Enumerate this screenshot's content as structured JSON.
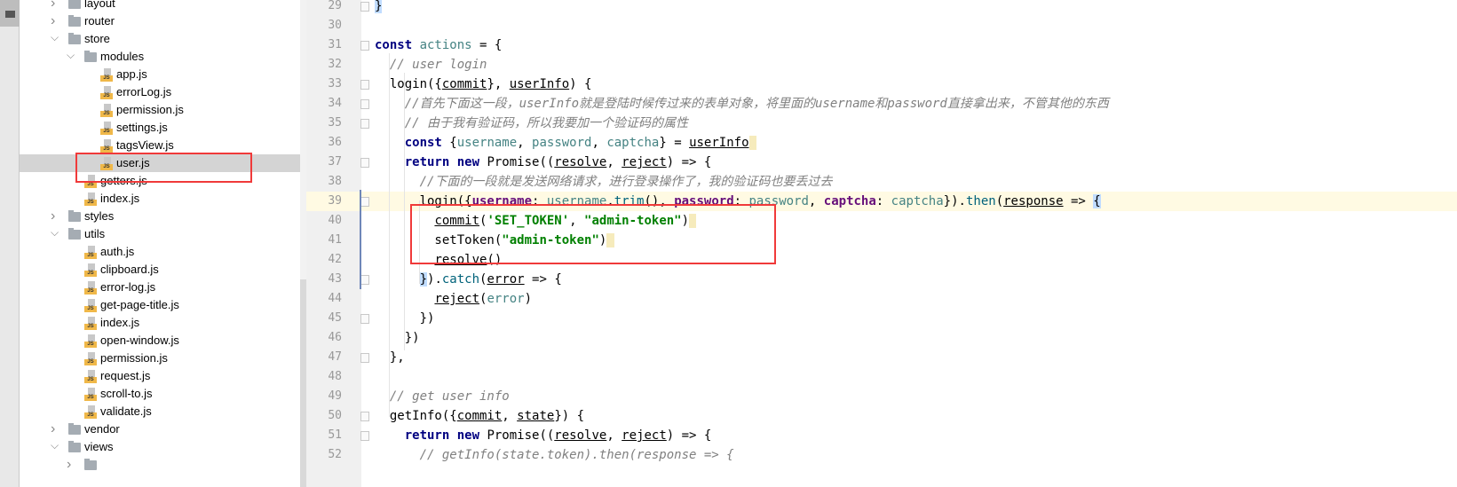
{
  "tree": [
    {
      "label": "layout",
      "type": "folder",
      "depth": 1,
      "expanded": false
    },
    {
      "label": "router",
      "type": "folder",
      "depth": 1,
      "expanded": false
    },
    {
      "label": "store",
      "type": "folder",
      "depth": 1,
      "expanded": true
    },
    {
      "label": "modules",
      "type": "folder",
      "depth": 2,
      "expanded": true
    },
    {
      "label": "app.js",
      "type": "js",
      "depth": 3
    },
    {
      "label": "errorLog.js",
      "type": "js",
      "depth": 3
    },
    {
      "label": "permission.js",
      "type": "js",
      "depth": 3
    },
    {
      "label": "settings.js",
      "type": "js",
      "depth": 3
    },
    {
      "label": "tagsView.js",
      "type": "js",
      "depth": 3
    },
    {
      "label": "user.js",
      "type": "js",
      "depth": 3,
      "selected": true
    },
    {
      "label": "getters.js",
      "type": "js",
      "depth": 2
    },
    {
      "label": "index.js",
      "type": "js",
      "depth": 2
    },
    {
      "label": "styles",
      "type": "folder",
      "depth": 1,
      "expanded": false
    },
    {
      "label": "utils",
      "type": "folder",
      "depth": 1,
      "expanded": true
    },
    {
      "label": "auth.js",
      "type": "js",
      "depth": 2
    },
    {
      "label": "clipboard.js",
      "type": "js",
      "depth": 2
    },
    {
      "label": "error-log.js",
      "type": "js",
      "depth": 2
    },
    {
      "label": "get-page-title.js",
      "type": "js",
      "depth": 2
    },
    {
      "label": "index.js",
      "type": "js",
      "depth": 2
    },
    {
      "label": "open-window.js",
      "type": "js",
      "depth": 2
    },
    {
      "label": "permission.js",
      "type": "js",
      "depth": 2
    },
    {
      "label": "request.js",
      "type": "js",
      "depth": 2
    },
    {
      "label": "scroll-to.js",
      "type": "js",
      "depth": 2
    },
    {
      "label": "validate.js",
      "type": "js",
      "depth": 2
    },
    {
      "label": "vendor",
      "type": "folder",
      "depth": 1,
      "expanded": false
    },
    {
      "label": "views",
      "type": "folder",
      "depth": 1,
      "expanded": true
    },
    {
      "label": "",
      "type": "folder",
      "depth": 2,
      "expanded": false
    }
  ],
  "js_icon_label": "JS",
  "current_line": 39,
  "colors": {
    "highlight_box": "#f03a3a",
    "current_line": "#fffae3",
    "keyword": "#000080",
    "string": "#008000",
    "comment": "#808080"
  },
  "code": [
    {
      "n": 29,
      "t": [
        [
          "}",
          "br"
        ]
      ]
    },
    {
      "n": 30,
      "t": []
    },
    {
      "n": 31,
      "t": [
        [
          "const ",
          "kw"
        ],
        [
          "actions",
          "pr"
        ],
        [
          " = {",
          ""
        ]
      ]
    },
    {
      "n": 32,
      "t": [
        [
          "  // user login",
          "cm"
        ]
      ]
    },
    {
      "n": 33,
      "t": [
        [
          "  login({",
          ""
        ],
        [
          "commit",
          "u"
        ],
        [
          "}, ",
          ""
        ],
        [
          "userInfo",
          "u"
        ],
        [
          ") {",
          ""
        ]
      ]
    },
    {
      "n": 34,
      "t": [
        [
          "    //首先下面这一段，userInfo就是登陆时候传过来的表单对象，将里面的username和password直接拿出来，不管其他的东西",
          "cm"
        ]
      ]
    },
    {
      "n": 35,
      "t": [
        [
          "    // 由于我有验证码，所以我要加一个验证码的属性",
          "cm"
        ]
      ]
    },
    {
      "n": 36,
      "t": [
        [
          "    ",
          ""
        ],
        [
          "const ",
          "kw"
        ],
        [
          "{",
          ""
        ],
        [
          "username",
          "pr"
        ],
        [
          ", ",
          ""
        ],
        [
          "password",
          "pr"
        ],
        [
          ", ",
          ""
        ],
        [
          "captcha",
          "pr"
        ],
        [
          "} = ",
          ""
        ],
        [
          "userInfo",
          "u"
        ],
        [
          " ",
          "hl"
        ]
      ]
    },
    {
      "n": 37,
      "t": [
        [
          "    ",
          ""
        ],
        [
          "return new ",
          "kw"
        ],
        [
          "Promise((",
          ""
        ],
        [
          "resolve",
          "u"
        ],
        [
          ", ",
          ""
        ],
        [
          "reject",
          "u"
        ],
        [
          ") => {",
          ""
        ]
      ]
    },
    {
      "n": 38,
      "t": [
        [
          "      //下面的一段就是发送网络请求，进行登录操作了，我的验证码也要丢过去",
          "cm"
        ]
      ]
    },
    {
      "n": 39,
      "t": [
        [
          "      login({",
          ""
        ],
        [
          "username",
          "pk"
        ],
        [
          ": ",
          ""
        ],
        [
          "username",
          "pr"
        ],
        [
          ".",
          ""
        ],
        [
          "trim",
          "fn"
        ],
        [
          "(), ",
          ""
        ],
        [
          "password",
          "pk"
        ],
        [
          ": ",
          ""
        ],
        [
          "password",
          "pr"
        ],
        [
          ", ",
          ""
        ],
        [
          "captcha",
          "pk"
        ],
        [
          ": ",
          ""
        ],
        [
          "captcha",
          "pr"
        ],
        [
          "}).",
          ""
        ],
        [
          "then",
          "fn"
        ],
        [
          "(",
          ""
        ],
        [
          "response",
          "u"
        ],
        [
          " => ",
          ""
        ],
        [
          "{",
          "br"
        ]
      ]
    },
    {
      "n": 40,
      "t": [
        [
          "        ",
          ""
        ],
        [
          "commit",
          "u"
        ],
        [
          "(",
          ""
        ],
        [
          "'SET_TOKEN'",
          "st"
        ],
        [
          ", ",
          ""
        ],
        [
          "\"admin-token\"",
          "st"
        ],
        [
          ")",
          ""
        ],
        [
          " ",
          "hl"
        ]
      ]
    },
    {
      "n": 41,
      "t": [
        [
          "        setToken(",
          ""
        ],
        [
          "\"admin-token\"",
          "st"
        ],
        [
          ")",
          ""
        ],
        [
          " ",
          "hl"
        ]
      ]
    },
    {
      "n": 42,
      "t": [
        [
          "        ",
          ""
        ],
        [
          "resolve",
          "u"
        ],
        [
          "()",
          ""
        ]
      ]
    },
    {
      "n": 43,
      "t": [
        [
          "      ",
          ""
        ],
        [
          "}",
          "br"
        ],
        [
          ").",
          ""
        ],
        [
          "catch",
          "fn"
        ],
        [
          "(",
          ""
        ],
        [
          "error",
          "u"
        ],
        [
          " => {",
          ""
        ]
      ]
    },
    {
      "n": 44,
      "t": [
        [
          "        ",
          ""
        ],
        [
          "reject",
          "u"
        ],
        [
          "(",
          ""
        ],
        [
          "error",
          "pr"
        ],
        [
          ")",
          ""
        ]
      ]
    },
    {
      "n": 45,
      "t": [
        [
          "      })",
          ""
        ]
      ]
    },
    {
      "n": 46,
      "t": [
        [
          "    })",
          ""
        ]
      ]
    },
    {
      "n": 47,
      "t": [
        [
          "  },",
          ""
        ]
      ]
    },
    {
      "n": 48,
      "t": []
    },
    {
      "n": 49,
      "t": [
        [
          "  // get user info",
          "cm"
        ]
      ]
    },
    {
      "n": 50,
      "t": [
        [
          "  getInfo({",
          ""
        ],
        [
          "commit",
          "u"
        ],
        [
          ", ",
          ""
        ],
        [
          "state",
          "u"
        ],
        [
          "}) {",
          ""
        ]
      ]
    },
    {
      "n": 51,
      "t": [
        [
          "    ",
          ""
        ],
        [
          "return new ",
          "kw"
        ],
        [
          "Promise((",
          ""
        ],
        [
          "resolve",
          "u"
        ],
        [
          ", ",
          ""
        ],
        [
          "reject",
          "u"
        ],
        [
          ") => {",
          ""
        ]
      ]
    },
    {
      "n": 52,
      "t": [
        [
          "      // getInfo(state.token).then(response => {",
          "cm"
        ]
      ]
    }
  ]
}
